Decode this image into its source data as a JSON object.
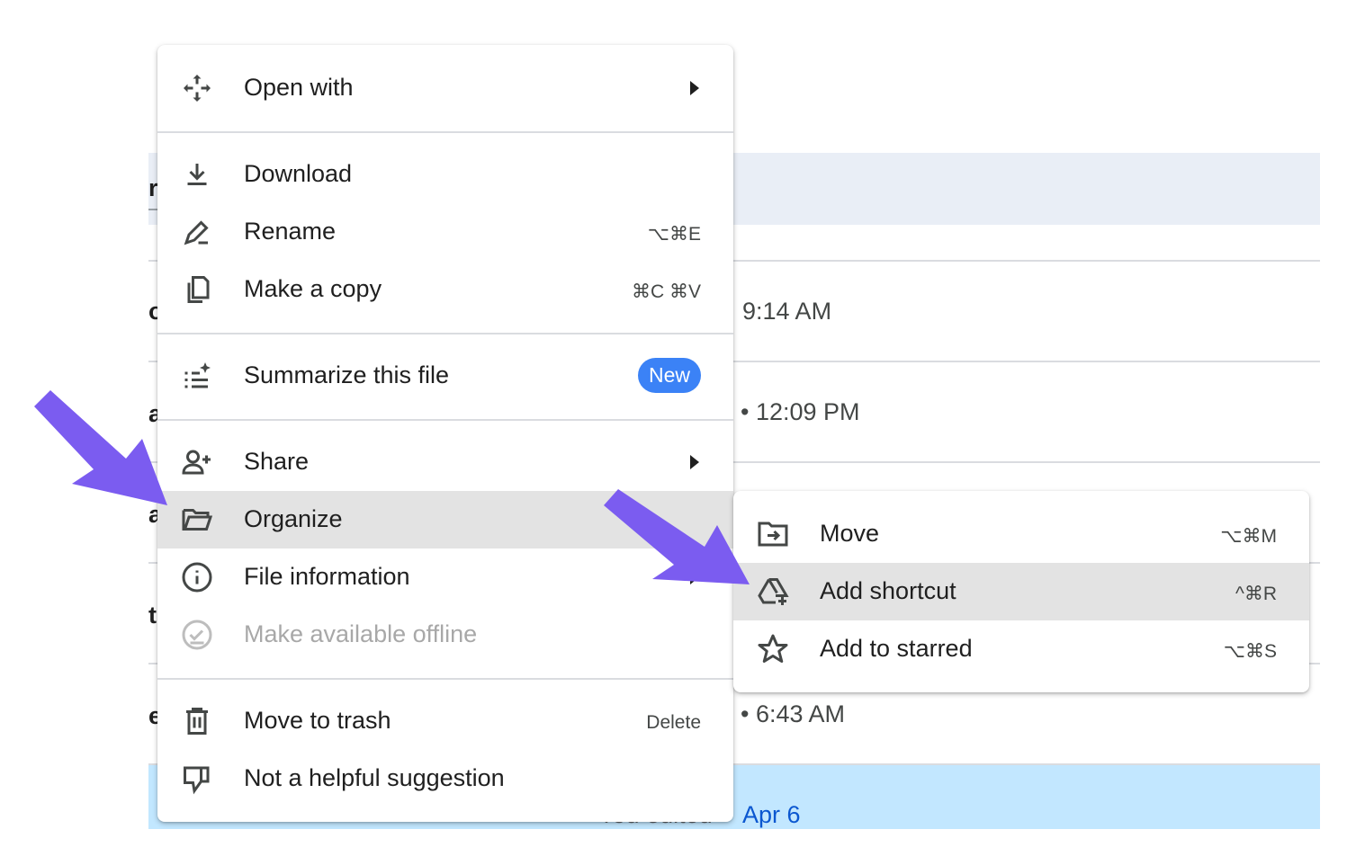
{
  "background": {
    "fragments": [
      "ri",
      "oa",
      "a",
      "a",
      "te",
      "e"
    ],
    "times": [
      "9:14 AM",
      "• 12:09 PM",
      "• 6:43 AM"
    ],
    "selected_row": {
      "faded_text": "You edited",
      "date": "Apr 6"
    }
  },
  "menu": {
    "items": [
      {
        "label": "Open with",
        "icon": "move-arrows-icon",
        "submenu": true
      },
      {
        "label": "Download",
        "icon": "download-icon"
      },
      {
        "label": "Rename",
        "icon": "rename-pencil-icon",
        "shortcut": "⌥⌘E"
      },
      {
        "label": "Make a copy",
        "icon": "copy-icon",
        "shortcut": "⌘C ⌘V"
      },
      {
        "label": "Summarize this file",
        "icon": "summarize-sparkle-icon",
        "badge": "New"
      },
      {
        "label": "Share",
        "icon": "person-add-icon",
        "submenu": true
      },
      {
        "label": "Organize",
        "icon": "folder-open-icon",
        "submenu": true,
        "active": true
      },
      {
        "label": "File information",
        "icon": "info-icon",
        "submenu": true
      },
      {
        "label": "Make available offline",
        "icon": "offline-check-icon",
        "disabled": true
      },
      {
        "label": "Move to trash",
        "icon": "trash-icon",
        "shortcut": "Delete"
      },
      {
        "label": "Not a helpful suggestion",
        "icon": "thumbs-down-icon"
      }
    ]
  },
  "submenu": {
    "items": [
      {
        "label": "Move",
        "icon": "move-folder-icon",
        "shortcut": "⌥⌘M"
      },
      {
        "label": "Add shortcut",
        "icon": "add-shortcut-icon",
        "shortcut": "^⌘R",
        "active": true
      },
      {
        "label": "Add to starred",
        "icon": "star-icon",
        "shortcut": "⌥⌘S"
      }
    ]
  },
  "colors": {
    "annotation_arrow": "#7b5cf0",
    "badge": "#3b82f6",
    "highlight_row": "#e9eef6",
    "selected_row": "#c2e7ff",
    "active_item": "#e3e3e3"
  }
}
